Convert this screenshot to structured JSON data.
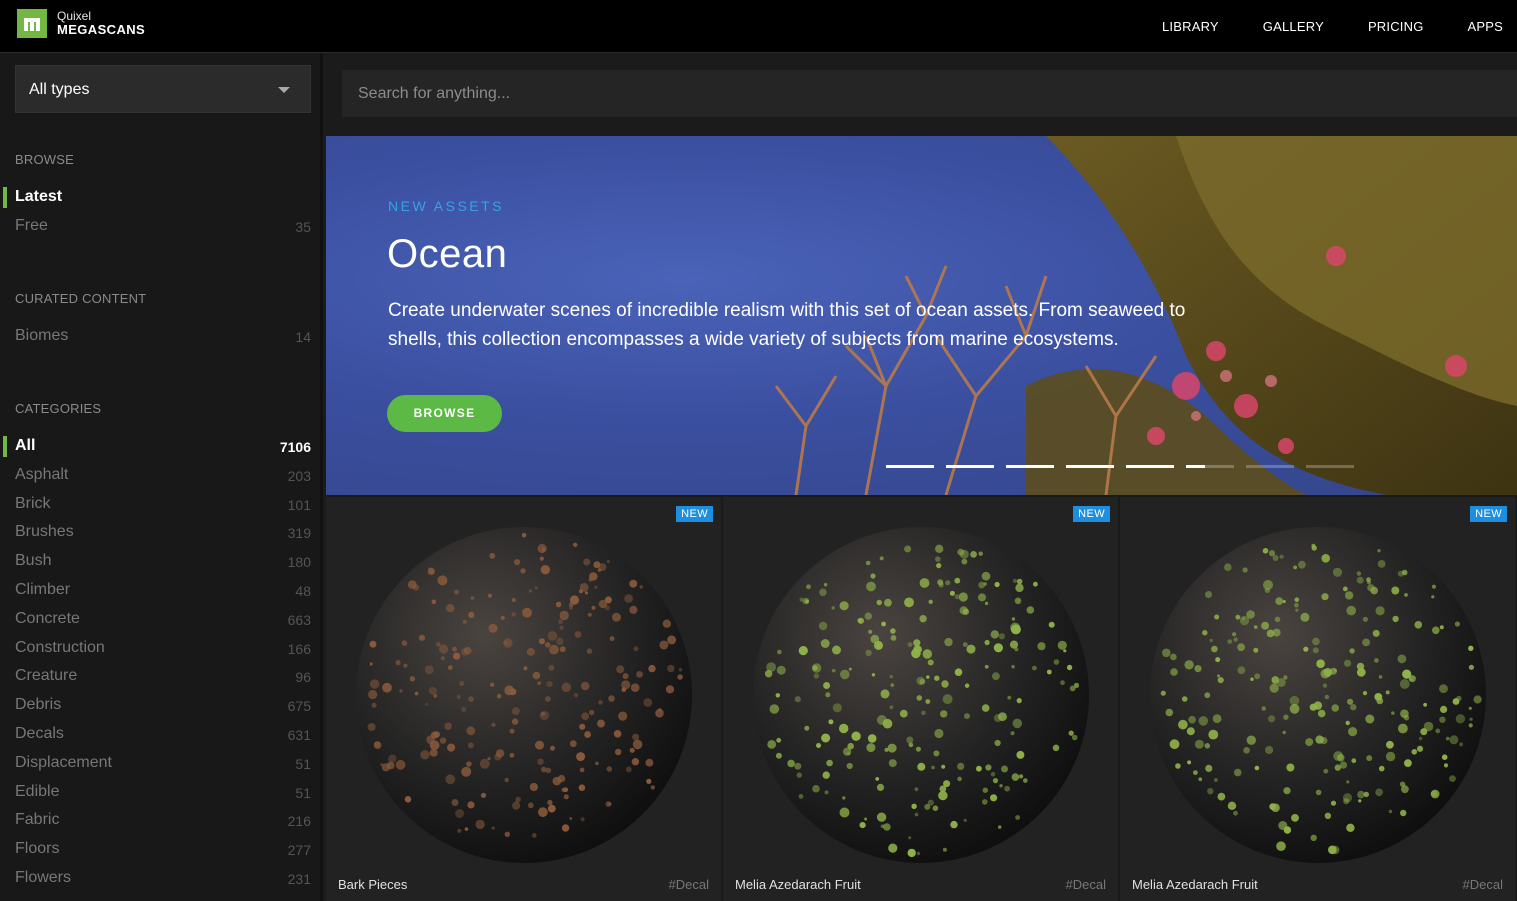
{
  "app": {
    "brand_top": "Quixel",
    "brand_bottom": "MEGASCANS"
  },
  "nav": {
    "library": "LIBRARY",
    "gallery": "GALLERY",
    "pricing": "PRICING",
    "apps": "APPS"
  },
  "type_select": {
    "value": "All types"
  },
  "search": {
    "placeholder": "Search for anything..."
  },
  "sidebar": {
    "browse_title": "BROWSE",
    "browse": [
      {
        "label": "Latest",
        "count": ""
      },
      {
        "label": "Free",
        "count": "35"
      }
    ],
    "curated_title": "CURATED CONTENT",
    "curated": [
      {
        "label": "Biomes",
        "count": "14"
      }
    ],
    "categories_title": "CATEGORIES",
    "categories": [
      {
        "label": "All",
        "count": "7106"
      },
      {
        "label": "Asphalt",
        "count": "203"
      },
      {
        "label": "Brick",
        "count": "101"
      },
      {
        "label": "Brushes",
        "count": "319"
      },
      {
        "label": "Bush",
        "count": "180"
      },
      {
        "label": "Climber",
        "count": "48"
      },
      {
        "label": "Concrete",
        "count": "663"
      },
      {
        "label": "Construction",
        "count": "166"
      },
      {
        "label": "Creature",
        "count": "96"
      },
      {
        "label": "Debris",
        "count": "675"
      },
      {
        "label": "Decals",
        "count": "631"
      },
      {
        "label": "Displacement",
        "count": "51"
      },
      {
        "label": "Edible",
        "count": "51"
      },
      {
        "label": "Fabric",
        "count": "216"
      },
      {
        "label": "Floors",
        "count": "277"
      },
      {
        "label": "Flowers",
        "count": "231"
      }
    ]
  },
  "hero": {
    "eyebrow": "NEW ASSETS",
    "title": "Ocean",
    "description": "Create underwater scenes of incredible realism with this set of ocean assets. From seaweed to shells, this collection encompasses a wide variety of subjects from marine ecosystems.",
    "button": "BROWSE",
    "slides_total": 8,
    "active_slides": 5
  },
  "cards": [
    {
      "badge": "NEW",
      "name": "Bark Pieces",
      "tag": "#Decal",
      "accent": "#8a5a3c"
    },
    {
      "badge": "NEW",
      "name": "Melia Azedarach Fruit",
      "tag": "#Decal",
      "accent": "#8fb24a"
    },
    {
      "badge": "NEW",
      "name": "Melia Azedarach Fruit",
      "tag": "#Decal",
      "accent": "#8fb24a"
    }
  ],
  "colors": {
    "accent_green": "#72b843",
    "badge_blue": "#1e8fe0",
    "eyebrow_blue": "#3aa0e8"
  }
}
